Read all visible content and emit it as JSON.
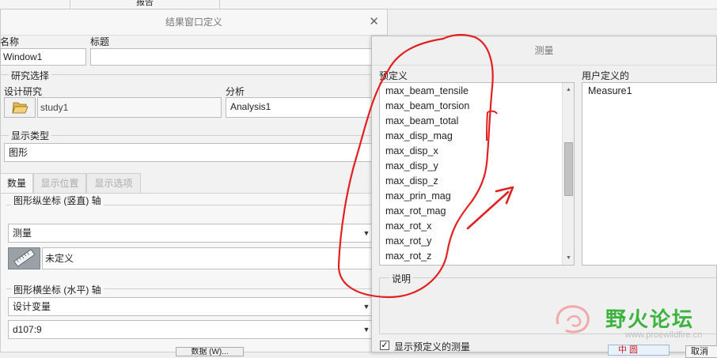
{
  "top_tab": "报告",
  "result_dialog": {
    "title": "结果窗口定义",
    "name_label": "名称",
    "name_value": "Window1",
    "caption_label": "标题",
    "caption_value": "",
    "study_group": "研究选择",
    "design_study_label": "设计研究",
    "design_study_value": "study1",
    "analysis_label": "分析",
    "analysis_value": "Analysis1",
    "display_type_group": "显示类型",
    "display_type_value": "图形",
    "tabs": [
      "数量",
      "显示位置",
      "显示选项"
    ],
    "y_axis_group": "图形纵坐标 (竖直) 轴",
    "y_axis_value": "测量",
    "y_measure_value": "未定义",
    "x_axis_group": "图形横坐标 (水平) 轴",
    "x_axis_value": "设计变量",
    "x_param_value": "d107:9",
    "bottom_button": "数据 (W)..."
  },
  "measure_dialog": {
    "title": "测量",
    "predefined_label": "预定义",
    "predefined_items": [
      "max_beam_tensile",
      "max_beam_torsion",
      "max_beam_total",
      "max_disp_mag",
      "max_disp_x",
      "max_disp_y",
      "max_disp_z",
      "max_prin_mag",
      "max_rot_mag",
      "max_rot_x",
      "max_rot_y",
      "max_rot_z"
    ],
    "user_defined_label": "用户定义的",
    "user_defined_items": [
      "Measure1"
    ],
    "description_label": "说明",
    "show_predefined_label": "显示预定义的测量",
    "show_predefined_checked": true,
    "cancel_button": "取消"
  },
  "annotations": {
    "color": "#e32020"
  },
  "watermark": {
    "text": "野火论坛",
    "url": "www.proewildfire.cn",
    "badge": "中 圆"
  }
}
